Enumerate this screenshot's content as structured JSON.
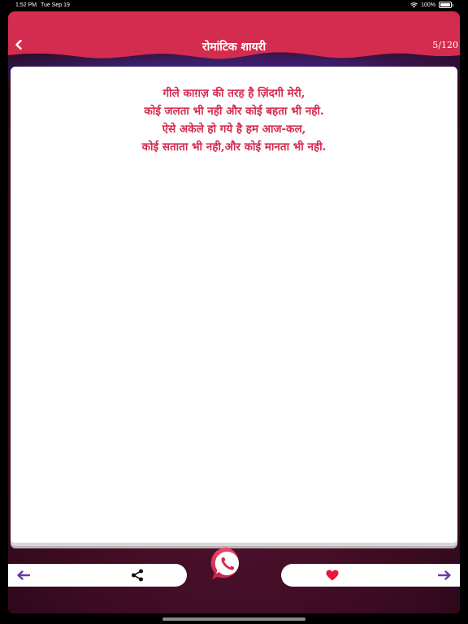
{
  "status_bar": {
    "time": "1:52 PM",
    "date": "Tue Sep 19",
    "battery": "100%"
  },
  "header": {
    "title": "रोमांटिक शायरी",
    "counter": "5/120"
  },
  "poem": {
    "lines": [
      "गीले काग़ज़ की तरह है ज़िंदगी मेरी,",
      "कोई जलता भी नही और कोई बहता भी नही.",
      "ऐसे अकेले हो गये है हम आज-कल,",
      "कोई सताता भी नही,और कोई मानता भी नही."
    ]
  },
  "colors": {
    "header": "#d42c4e",
    "poem_text": "#d42c4e",
    "arrow": "#6a3aa8",
    "heart": "#e8173a",
    "whatsapp_bg": "#e0385a"
  },
  "icons": {
    "back": "chevron-left-icon",
    "prev": "arrow-left-icon",
    "share": "share-icon",
    "whatsapp": "whatsapp-icon",
    "favorite": "heart-icon",
    "next": "arrow-right-icon"
  }
}
